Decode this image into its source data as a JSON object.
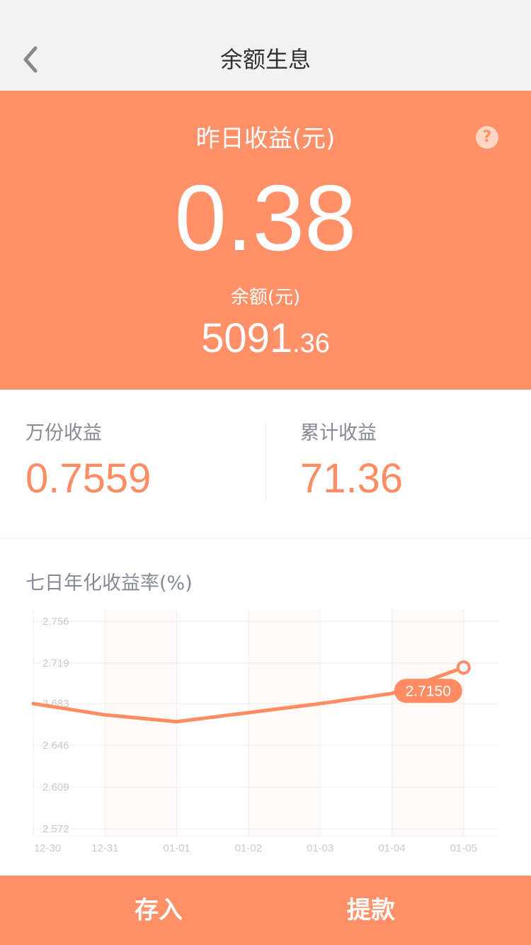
{
  "nav": {
    "back_icon": "chevron-left-icon",
    "title": "余额生息"
  },
  "hero": {
    "yesterday_label": "昨日收益(元)",
    "yesterday_value": "0.38",
    "help_icon": "question-circle-icon",
    "help_glyph": "?",
    "balance_label": "余额(元)",
    "balance_int": "5091",
    "balance_dec": ".36"
  },
  "stats": {
    "per10k_label": "万份收益",
    "per10k_value": "0.7559",
    "total_label": "累计收益",
    "total_value": "71.36"
  },
  "chart": {
    "title": "七日年化收益率(%)",
    "chart_data": {
      "type": "line",
      "x": [
        "12-30",
        "12-31",
        "01-01",
        "01-02",
        "01-03",
        "01-04",
        "01-05"
      ],
      "y_ticks": [
        "2.756",
        "2.719",
        "2.683",
        "2.646",
        "2.609",
        "2.572"
      ],
      "ylim": [
        2.572,
        2.756
      ],
      "series": [
        {
          "values": [
            2.683,
            2.673,
            2.667,
            2.675,
            2.683,
            2.692,
            2.715
          ]
        }
      ],
      "highlight_label": "2.7150",
      "line_color": "#ff8c62",
      "grid": true
    }
  },
  "bottom": {
    "deposit_label": "存入",
    "withdraw_label": "提款"
  },
  "colors": {
    "accent": "#ff9068",
    "text_muted": "#858a96"
  }
}
